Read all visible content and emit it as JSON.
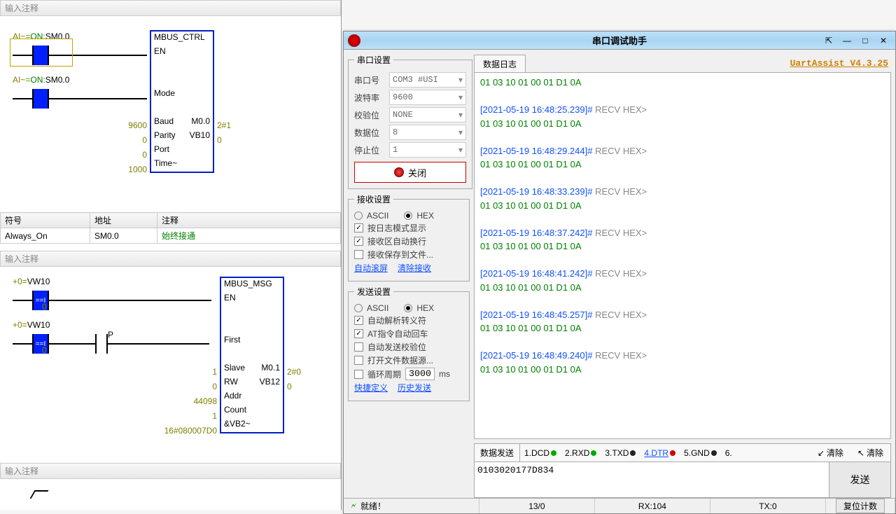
{
  "plc": {
    "net_header": "输入注释",
    "rung1_label_pre1": "AI~=",
    "rung1_label_pre2": "ON:",
    "rung1_label_addr": "SM0.0",
    "box1": {
      "title": "MBUS_CTRL",
      "en": "EN",
      "mode": "Mode",
      "rows": [
        {
          "left": "9600",
          "mid": "Baud",
          "right": "M0.0",
          "out": "2#1"
        },
        {
          "left": "0",
          "mid": "Parity",
          "right": "VB10",
          "out": "0"
        },
        {
          "left": "0",
          "mid": "Port",
          "right": "",
          "out": ""
        },
        {
          "left": "1000",
          "mid": "Time~",
          "right": "",
          "out": ""
        }
      ]
    },
    "symtable": {
      "h1": "符号",
      "h2": "地址",
      "h3": "注释",
      "r1c1": "Always_On",
      "r1c2": "SM0.0",
      "r1c3": "始终接通"
    },
    "net_header2": "输入注释",
    "rung3_pre1": "+0=",
    "rung3_addr": "VW10",
    "rung3_val": "0",
    "pcoil": "P",
    "box2": {
      "title": "MBUS_MSG",
      "en": "EN",
      "first": "First",
      "rows": [
        {
          "left": "1",
          "mid": "Slave",
          "right": "M0.1",
          "out": "2#0"
        },
        {
          "left": "0",
          "mid": "RW",
          "right": "VB12",
          "out": "0"
        },
        {
          "left": "44098",
          "mid": "Addr",
          "right": "",
          "out": ""
        },
        {
          "left": "1",
          "mid": "Count",
          "right": "",
          "out": ""
        },
        {
          "left": "16#080007D0",
          "mid": "&VB2~",
          "right": "",
          "out": ""
        }
      ]
    },
    "net_header3": "输入注释"
  },
  "uart": {
    "title": "串口调试助手",
    "product": "UartAssist V4.3.25",
    "sections": {
      "port_settings": "串口设置",
      "recv_settings": "接收设置",
      "send_settings": "发送设置",
      "data_log": "数据日志",
      "data_send": "数据发送"
    },
    "port": {
      "port_label": "串口号",
      "port_val": "COM3 #USI",
      "baud_label": "波特率",
      "baud_val": "9600",
      "parity_label": "校验位",
      "parity_val": "NONE",
      "data_label": "数据位",
      "data_val": "8",
      "stop_label": "停止位",
      "stop_val": "1",
      "close_btn": "关闭"
    },
    "recv": {
      "ascii": "ASCII",
      "hex": "HEX",
      "opt1": "按日志模式显示",
      "opt2": "接收区自动换行",
      "opt3": "接收保存到文件...",
      "link1": "自动滚屏",
      "link2": "清除接收"
    },
    "send": {
      "ascii": "ASCII",
      "hex": "HEX",
      "opt1": "自动解析转义符",
      "opt2": "AT指令自动回车",
      "opt3": "自动发送校验位",
      "opt4": "打开文件数据源...",
      "cycle": "循环周期",
      "cycle_val": "3000",
      "cycle_ms": "ms",
      "link1": "快捷定义",
      "link2": "历史发送"
    },
    "log_entries": [
      {
        "ts": "",
        "data": "01 03 10 01 00 01 D1 0A"
      },
      {
        "ts": "[2021-05-19 16:48:25.239]# RECV HEX>",
        "data": "01 03 10 01 00 01 D1 0A"
      },
      {
        "ts": "[2021-05-19 16:48:29.244]# RECV HEX>",
        "data": "01 03 10 01 00 01 D1 0A"
      },
      {
        "ts": "[2021-05-19 16:48:33.239]# RECV HEX>",
        "data": "01 03 10 01 00 01 D1 0A"
      },
      {
        "ts": "[2021-05-19 16:48:37.242]# RECV HEX>",
        "data": "01 03 10 01 00 01 D1 0A"
      },
      {
        "ts": "[2021-05-19 16:48:41.242]# RECV HEX>",
        "data": "01 03 10 01 00 01 D1 0A"
      },
      {
        "ts": "[2021-05-19 16:48:45.257]# RECV HEX>",
        "data": "01 03 10 01 00 01 D1 0A"
      },
      {
        "ts": "[2021-05-19 16:48:49.240]# RECV HEX>",
        "data": "01 03 10 01 00 01 D1 0A"
      }
    ],
    "signals": [
      {
        "n": "1.DCD",
        "c": "dot-g"
      },
      {
        "n": "2.RXD",
        "c": "dot-g"
      },
      {
        "n": "3.TXD",
        "c": "dot-b"
      },
      {
        "n": "4.DTR",
        "c": "dot-r",
        "link": true
      },
      {
        "n": "5.GND",
        "c": "dot-b"
      },
      {
        "n": "6.",
        "c": ""
      }
    ],
    "clear": "清除",
    "send_input": "0103020177D834",
    "send_btn": "发送",
    "status": {
      "ready": "就绪！",
      "counts": "13/0",
      "rx": "RX:104",
      "tx": "TX:0",
      "reset": "复位计数"
    }
  }
}
